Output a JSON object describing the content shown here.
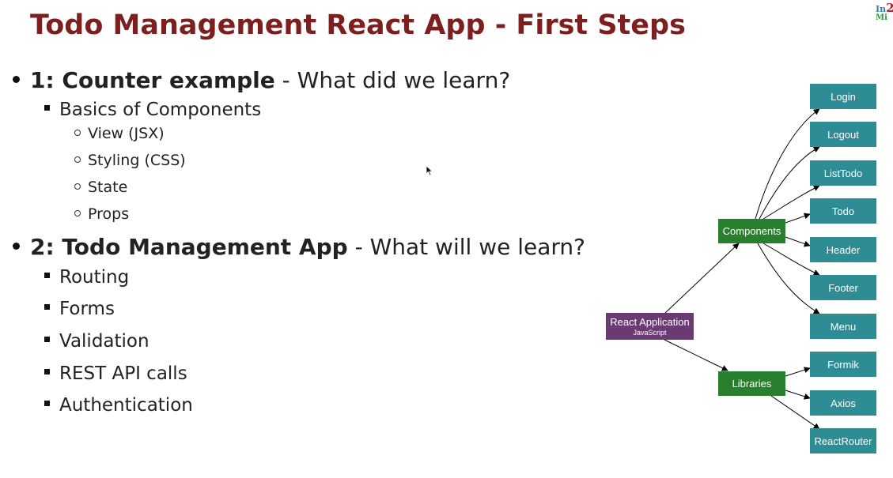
{
  "slide": {
    "title": "Todo Management React App - First Steps",
    "logo": {
      "line1_prefix": "In",
      "line1_num": "2",
      "line2": "Mi"
    }
  },
  "bullets": {
    "item1": {
      "strong": "1: Counter example",
      "rest": " - What did we learn?",
      "sub": {
        "label": "Basics of Components",
        "items": [
          "View (JSX)",
          "Styling (CSS)",
          "State",
          "Props"
        ]
      }
    },
    "item2": {
      "strong": "2: Todo Management App",
      "rest": " - What will we learn?",
      "items": [
        "Routing",
        "Forms",
        "Validation",
        "REST API calls",
        "Authentication"
      ]
    }
  },
  "diagram": {
    "root": {
      "label": "React Application",
      "sublabel": "JavaScript"
    },
    "components": {
      "label": "Components",
      "children": [
        "Login",
        "Logout",
        "ListTodo",
        "Todo",
        "Header",
        "Footer",
        "Menu"
      ]
    },
    "libraries": {
      "label": "Libraries",
      "children": [
        "Formik",
        "Axios",
        "ReactRouter"
      ]
    },
    "colors": {
      "title": "#7d1f1f",
      "leaf": "#2e8c95",
      "group": "#2a7f2f",
      "root": "#6a3a73"
    }
  }
}
